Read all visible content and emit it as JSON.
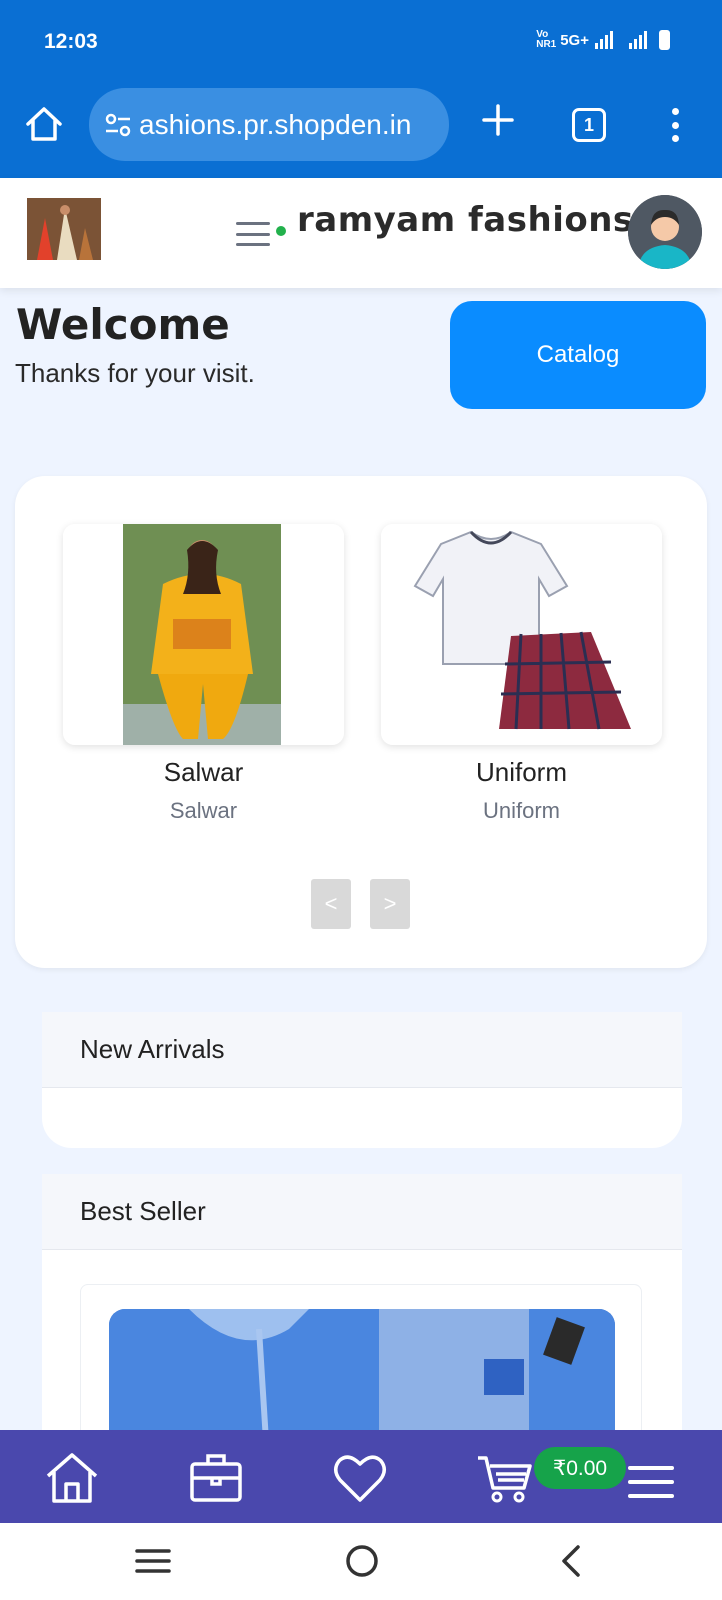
{
  "status_bar": {
    "time": "12:03",
    "network": "5G+",
    "volte": "Vo NR1"
  },
  "browser": {
    "url": "ashions.pr.shopden.in",
    "tab_count": "1"
  },
  "site": {
    "brand": "ramyam fashions",
    "logo_alt": "store logo",
    "avatar_alt": "user avatar"
  },
  "welcome": {
    "title": "Welcome",
    "subtitle": "Thanks for your visit.",
    "catalog_label": "Catalog"
  },
  "categories": [
    {
      "title": "Salwar",
      "subtitle": "Salwar"
    },
    {
      "title": "Uniform",
      "subtitle": "Uniform"
    }
  ],
  "carousel": {
    "prev": "<",
    "next": ">"
  },
  "sections": {
    "new_arrivals": "New Arrivals",
    "best_seller": "Best Seller"
  },
  "bottom_nav": {
    "cart_total": "₹0.00",
    "items": [
      "home-icon",
      "briefcase-icon",
      "heart-icon",
      "cart-icon",
      "menu-icon"
    ]
  },
  "colors": {
    "browser_chrome": "#0a6fd3",
    "catalog_button": "#0a8cff",
    "bottom_nav": "#4a48ad",
    "cart_badge": "#16a34a",
    "online_dot": "#22b14c"
  }
}
